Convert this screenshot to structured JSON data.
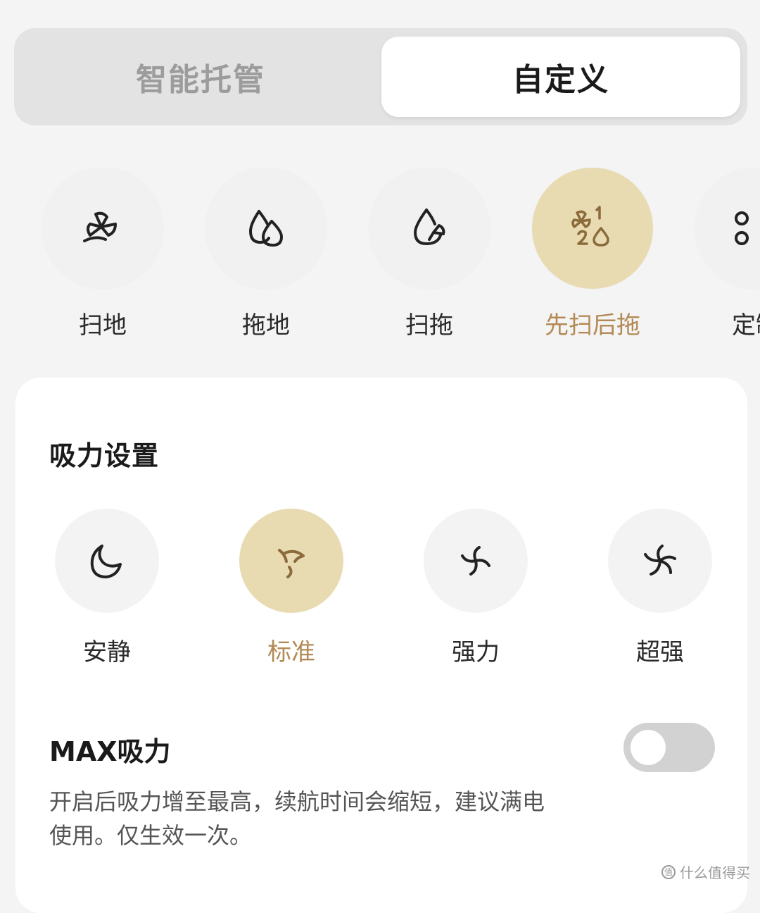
{
  "tabs": {
    "left_label": "智能托管",
    "right_label": "自定义"
  },
  "modes": [
    {
      "label": "扫地",
      "icon": "sweep-fan-icon"
    },
    {
      "label": "拖地",
      "icon": "water-drops-icon"
    },
    {
      "label": "扫拖",
      "icon": "drop-fan-icon"
    },
    {
      "label": "先扫后拖",
      "icon": "sweep-then-mop-icon",
      "active": true
    },
    {
      "label": "定制",
      "icon": "custom-icon"
    }
  ],
  "suction": {
    "title": "吸力设置",
    "levels": [
      {
        "label": "安静",
        "icon": "moon-icon"
      },
      {
        "label": "标准",
        "icon": "fan-standard-icon",
        "active": true
      },
      {
        "label": "强力",
        "icon": "fan-strong-icon"
      },
      {
        "label": "超强",
        "icon": "fan-super-icon"
      }
    ]
  },
  "max_suction": {
    "title": "MAX吸力",
    "description": "开启后吸力增至最高，续航时间会缩短，建议满电使用。仅生效一次。",
    "enabled": false
  },
  "watermark": {
    "text": "什么值得买"
  },
  "colors": {
    "accent": "#b38a55",
    "accent_bg": "#e9dbb1",
    "background": "#f4f4f4",
    "toggle_off": "#d2d2d2"
  }
}
